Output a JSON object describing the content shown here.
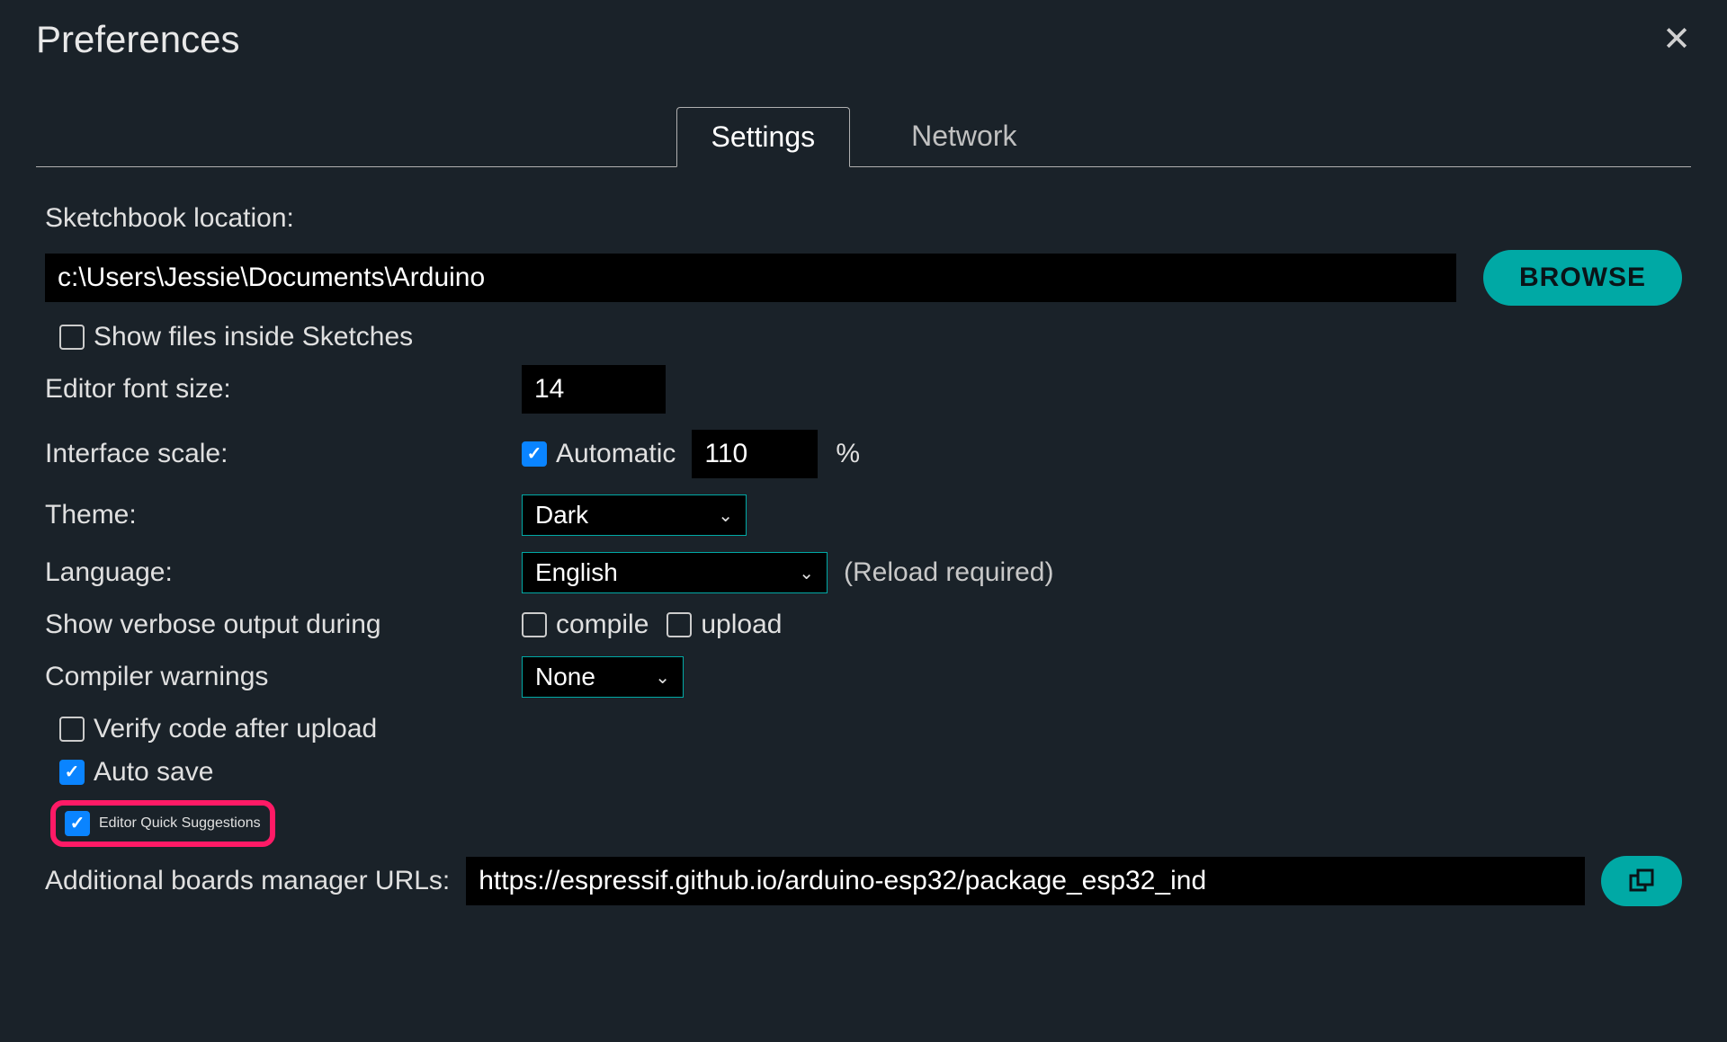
{
  "dialog": {
    "title": "Preferences"
  },
  "tabs": {
    "settings": "Settings",
    "network": "Network"
  },
  "fields": {
    "sketchbook_label": "Sketchbook location:",
    "sketchbook_value": "c:\\Users\\Jessie\\Documents\\Arduino",
    "browse": "BROWSE",
    "show_files_label": "Show files inside Sketches",
    "font_size_label": "Editor font size:",
    "font_size_value": "14",
    "interface_scale_label": "Interface scale:",
    "automatic_label": "Automatic",
    "interface_scale_value": "110",
    "percent": "%",
    "theme_label": "Theme:",
    "theme_value": "Dark",
    "language_label": "Language:",
    "language_value": "English",
    "reload_hint": "(Reload required)",
    "verbose_label": "Show verbose output during",
    "compile_label": "compile",
    "upload_label": "upload",
    "compiler_warnings_label": "Compiler warnings",
    "compiler_warnings_value": "None",
    "verify_label": "Verify code after upload",
    "autosave_label": "Auto save",
    "quick_suggestions_label": "Editor Quick Suggestions",
    "boards_url_label": "Additional boards manager URLs:",
    "boards_url_value": "https://espressif.github.io/arduino-esp32/package_esp32_ind"
  }
}
